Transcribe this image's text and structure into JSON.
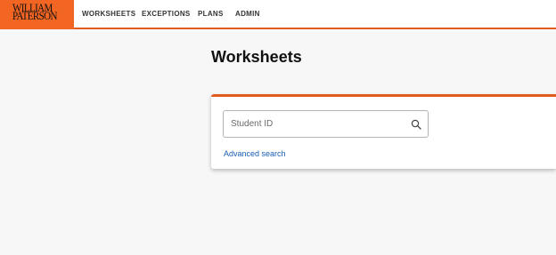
{
  "brand": {
    "line1": "WILLIAM",
    "line2": "PATERSON",
    "color": "#f26522"
  },
  "nav": {
    "items": [
      {
        "label": "WORKSHEETS"
      },
      {
        "label": "EXCEPTIONS"
      },
      {
        "label": "PLANS"
      },
      {
        "label": "ADMIN"
      }
    ]
  },
  "page": {
    "title": "Worksheets"
  },
  "search": {
    "placeholder": "Student ID",
    "value": "",
    "icon": "search-icon",
    "advanced_label": "Advanced search"
  },
  "colors": {
    "accent": "#e35a1f",
    "link": "#1a5fb4"
  }
}
